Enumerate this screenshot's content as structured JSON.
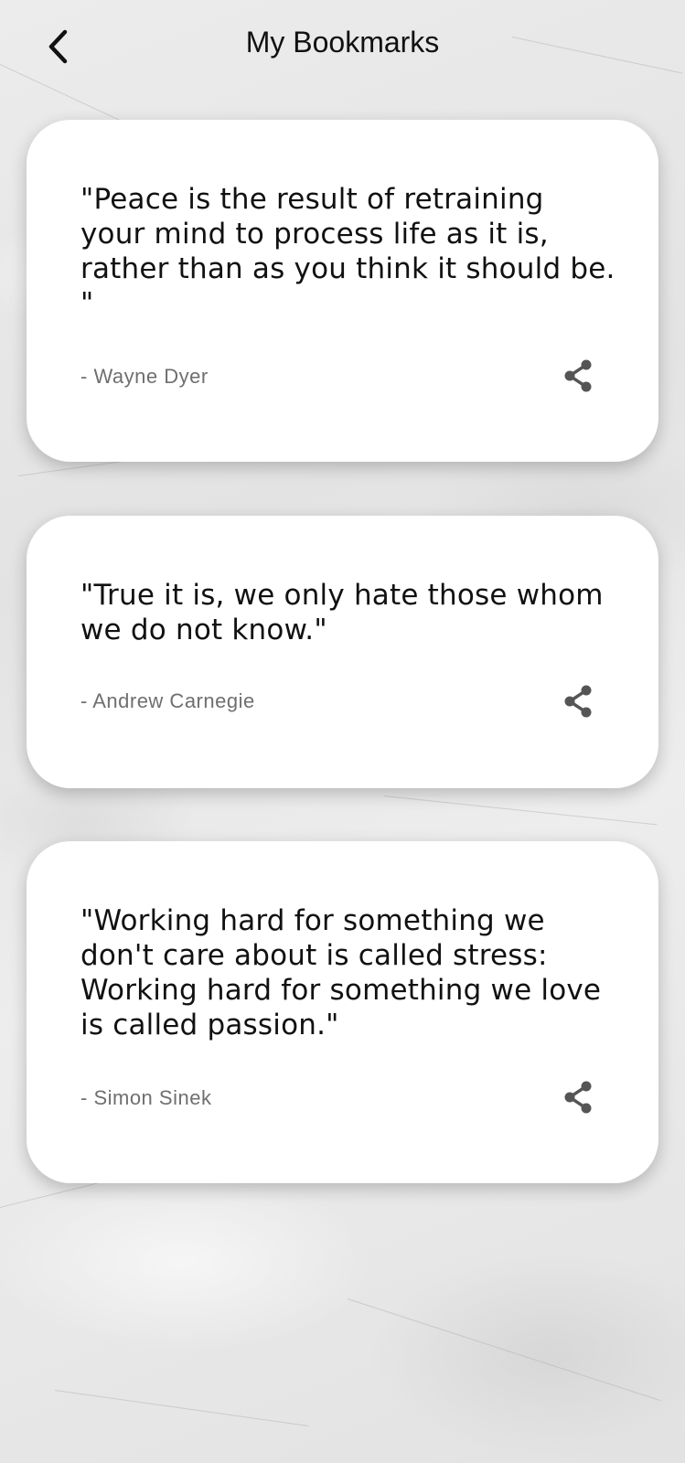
{
  "header": {
    "title": "My Bookmarks",
    "back_icon": "chevron-left-icon"
  },
  "bookmarks": [
    {
      "quote": "\"Peace is the result of retraining your mind to process life as it is, rather than as you think it should be.  \"",
      "author": "- Wayne Dyer",
      "share_icon": "share-icon"
    },
    {
      "quote": "\"True it is, we only hate those whom we do not know.\"",
      "author": "- Andrew Carnegie",
      "share_icon": "share-icon"
    },
    {
      "quote": "\"Working hard for something we don't care about is called stress: Working hard for something we love is called passion.\"",
      "author": "- Simon Sinek",
      "share_icon": "share-icon"
    }
  ],
  "colors": {
    "card_background": "#ffffff",
    "quote_text": "#111111",
    "author_text": "#6f6f6f",
    "icon": "#555555"
  }
}
